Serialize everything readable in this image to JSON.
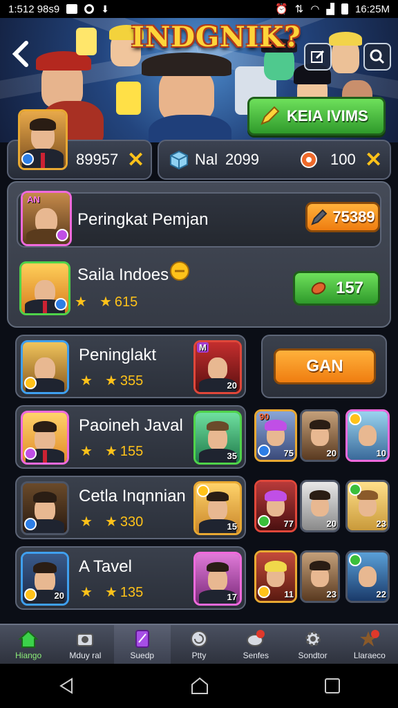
{
  "status_bar": {
    "time_left": "1:512 98s9",
    "time_right": "16:25M"
  },
  "banner": {
    "title": "INDGNIK?",
    "cta_label": "KEIA IVIMS"
  },
  "currency": {
    "left_value": "89957",
    "middle_label": "Nal",
    "middle_value": "2099",
    "right_value": "100"
  },
  "featured": {
    "header": {
      "name": "Peringkat Pemjan",
      "badge": "AN",
      "value": "75389"
    },
    "row": {
      "name": "Saila Indoes",
      "stars": "615",
      "button_value": "157"
    }
  },
  "list": [
    {
      "name": "Peninglakt",
      "stars": "355",
      "side_level": "20",
      "side_badge": "M",
      "button": "GAN"
    },
    {
      "name": "Paoineh Javal",
      "stars": "155",
      "side_level": "35",
      "thumbs": [
        "75",
        "20",
        "10"
      ],
      "thumb_badge": "90"
    },
    {
      "name": "Cetla Inqnnian",
      "stars": "330",
      "side_level": "15",
      "thumbs": [
        "77",
        "20",
        "23"
      ]
    },
    {
      "name": "A Tavel",
      "stars": "135",
      "level": "20",
      "side_level": "17",
      "thumbs": [
        "11",
        "23",
        "22"
      ]
    }
  ],
  "bottom_nav": [
    {
      "label": "Hiango",
      "icon": "home-icon"
    },
    {
      "label": "Mduy ral",
      "icon": "camera-icon"
    },
    {
      "label": "Suedp",
      "icon": "card-icon"
    },
    {
      "label": "Ptty",
      "icon": "spiral-icon"
    },
    {
      "label": "Senfes",
      "icon": "chat-icon"
    },
    {
      "label": "Sondtor",
      "icon": "gear-icon"
    },
    {
      "label": "Llaraeco",
      "icon": "star-icon"
    }
  ],
  "colors": {
    "gold": "#ffc21a",
    "green": "#2f9a2b",
    "orange": "#ef7d10",
    "panel": "#3a404c"
  }
}
